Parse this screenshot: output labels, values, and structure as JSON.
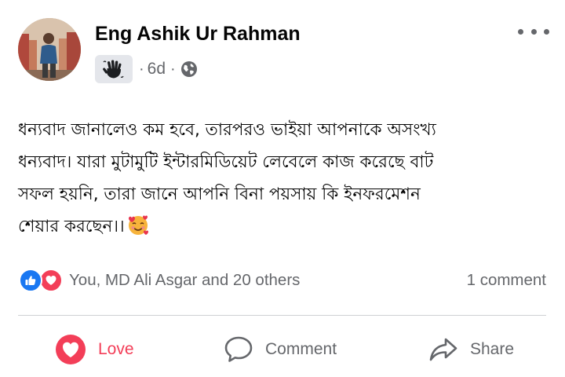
{
  "post": {
    "author_name": "Eng Ashik Ur Rahman",
    "time": "6d",
    "separator": "·",
    "audience_icon": "globe-icon",
    "badge_icon": "waving-hand-icon",
    "text_lines": [
      "ধন্যবাদ জানালেও কম হবে, তারপরও ভাইয়া আপনাকে অসংখ্য",
      "ধন্যবাদ। যারা মুটামুটি ইন্টারমিডিয়েট লেবেলে কাজ করেছে বাট",
      "সফল হয়নি, তারা জানে আপনি বিনা পয়সায় কি ইনফরমেশন",
      "শেয়ার করছেন।।"
    ],
    "text_emoji": "smiling-face-with-hearts-emoji"
  },
  "reactions": {
    "icons": [
      "like-icon",
      "love-icon"
    ],
    "summary": "You, MD Ali Asgar and 20 others",
    "comments": "1 comment"
  },
  "actions": {
    "love_label": "Love",
    "comment_label": "Comment",
    "share_label": "Share"
  },
  "colors": {
    "love": "#f33e58",
    "like": "#1877f2",
    "secondary_text": "#65676b",
    "divider": "#ced0d4"
  }
}
